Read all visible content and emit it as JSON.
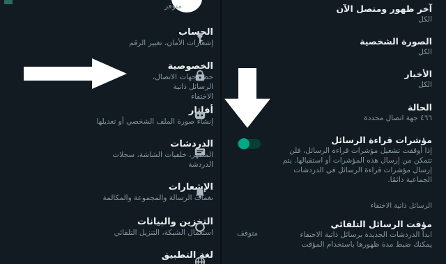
{
  "left": {
    "top_status": "متوفر",
    "items": [
      {
        "title": "الحساب",
        "subtitle": "إشعارات الأمان، تغيير الرقم",
        "icon": "key-icon"
      },
      {
        "title": "الخصوصية",
        "subtitle": "حظر جهات الاتصال، الرسائل ذاتية الاختفاء",
        "icon": "lock-icon"
      },
      {
        "title": "أفاتار",
        "subtitle": "إنشاء صورة الملف الشخصي أو تعديلها",
        "icon": "avatar-face-icon"
      },
      {
        "title": "الدردشات",
        "subtitle": "المظهر، خلفيات الشاشة، سجلات الدردشة",
        "icon": "chat-icon"
      },
      {
        "title": "الإشعارات",
        "subtitle": "نغمات الرسالة والمجموعة والمكالمة",
        "icon": "bell-icon"
      },
      {
        "title": "التخزين والبيانات",
        "subtitle": "استعمال الشبكة، التنزيل التلقائي",
        "icon": "storage-circle-icon"
      },
      {
        "title": "لغة التطبيق",
        "subtitle": "",
        "icon": "globe-icon"
      }
    ]
  },
  "right": {
    "items": [
      {
        "title": "آخر ظهور ومتصل الآن",
        "subtitle": "الكل"
      },
      {
        "title": "الصورة الشخصية",
        "subtitle": "الكل"
      },
      {
        "title": "الأخبار",
        "subtitle": "الكل"
      },
      {
        "title": "الحالة",
        "subtitle": "٤٦٦ جهة اتصال محددة"
      },
      {
        "title": "مؤشرات قراءة الرسائل",
        "subtitle": "إذا أوقفت تشغيل مؤشرات قراءة الرسائل، فلن تتمكن من إرسال هذه المؤشرات أو استقبالها. يتم إرسال مؤشرات قراءة الرسائل في الدردشات الجماعية دائمًا."
      },
      {
        "title": "مؤقت الرسائل التلقائي",
        "subtitle": "ابدأ الدردشات الجديدة برسائل ذاتية الاختفاء يمكنك ضبط مدة ظهورها باستخدام المؤقت"
      }
    ],
    "section_header": "الرسائل ذاتية الاختفاء",
    "timer_value": "متوقف",
    "read_receipts_on": true
  },
  "colors": {
    "background": "#121b22",
    "accent": "#00a884",
    "text_primary": "#e9edef",
    "text_secondary": "#8696a0",
    "arrow": "#ffffff"
  }
}
